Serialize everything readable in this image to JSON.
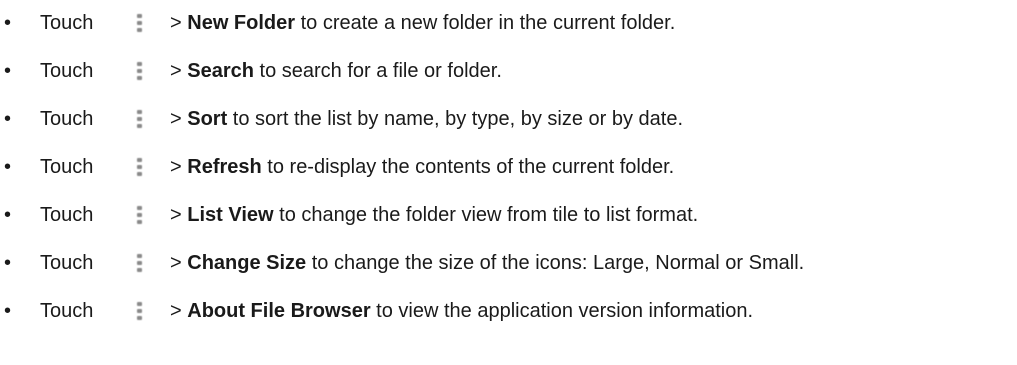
{
  "items": [
    {
      "bullet": "•",
      "verb": "Touch",
      "icon": "more-vert-icon",
      "gt": ">",
      "command": "New Folder",
      "desc": " to create a new folder in the current folder."
    },
    {
      "bullet": "•",
      "verb": "Touch",
      "icon": "more-vert-icon",
      "gt": ">",
      "command": "Search",
      "desc": " to search for a file or folder."
    },
    {
      "bullet": "•",
      "verb": "Touch",
      "icon": "more-vert-icon",
      "gt": ">",
      "command": "Sort",
      "desc": " to sort the list by name, by type, by size or by date."
    },
    {
      "bullet": "•",
      "verb": "Touch",
      "icon": "more-vert-icon",
      "gt": ">",
      "command": "Refresh",
      "desc": " to re-display the contents of the current folder."
    },
    {
      "bullet": "•",
      "verb": "Touch",
      "icon": "more-vert-icon",
      "gt": ">",
      "command": "List View",
      "desc": " to change the folder view from tile to list format."
    },
    {
      "bullet": "•",
      "verb": "Touch",
      "icon": "more-vert-icon",
      "gt": ">",
      "command": "Change Size",
      "desc": " to change the size of the icons: Large, Normal or Small."
    },
    {
      "bullet": "•",
      "verb": "Touch",
      "icon": "more-vert-icon",
      "gt": ">",
      "command": "About File Browser",
      "desc": " to view the application version information."
    }
  ]
}
